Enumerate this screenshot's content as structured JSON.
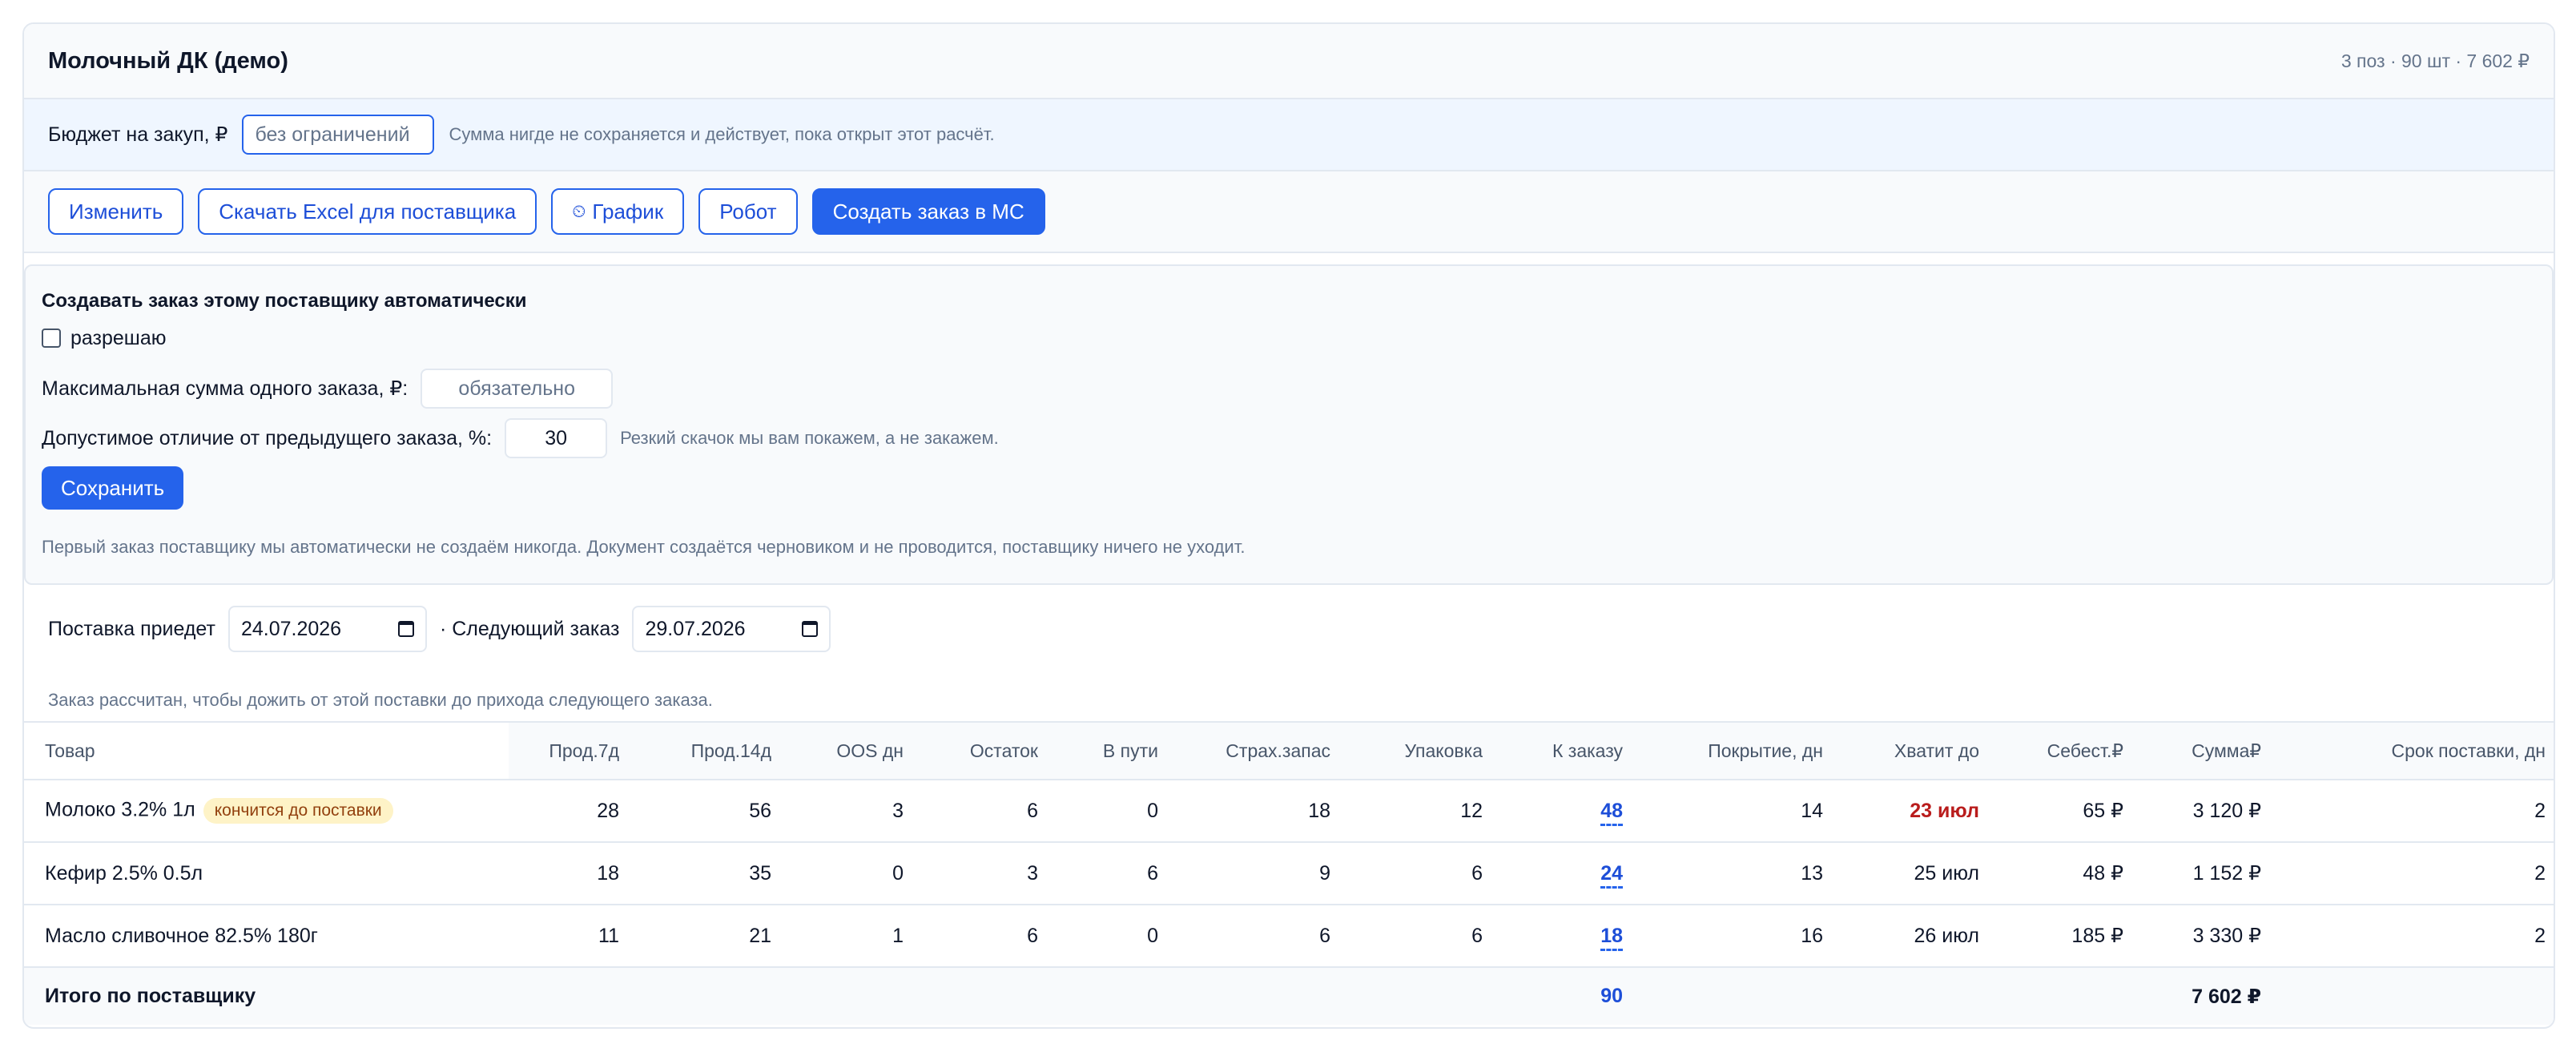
{
  "header": {
    "title": "Молочный ДК (демо)",
    "summary": "3 поз · 90 шт · 7 602 ₽"
  },
  "budget": {
    "label": "Бюджет на закуп, ₽",
    "placeholder": "без ограничений",
    "hint": "Сумма нигде не сохраняется и действует, пока открыт этот расчёт."
  },
  "actions": {
    "edit": "Изменить",
    "excel": "Скачать Excel для поставщика",
    "schedule_icon": "clock-icon",
    "schedule": "График",
    "robot": "Робот",
    "create_order": "Создать заказ в МС"
  },
  "auto_order": {
    "title": "Создавать заказ этому поставщику автоматически",
    "allow_label": "разрешаю",
    "allow_checked": false,
    "max_sum_label": "Максимальная сумма одного заказа, ₽:",
    "max_sum_placeholder": "обязательно",
    "deviation_label": "Допустимое отличие от предыдущего заказа, %:",
    "deviation_value": "30",
    "deviation_hint": "Резкий скачок мы вам покажем, а не закажем.",
    "save": "Сохранить",
    "note": "Первый заказ поставщику мы автоматически не создаём никогда. Документ создаётся черновиком и не проводится, поставщику ничего не уходит."
  },
  "dates": {
    "delivery_label": "Поставка приедет",
    "delivery_value": "24.07.2026",
    "next_label": "· Следующий заказ",
    "next_value": "29.07.2026",
    "note": "Заказ рассчитан, чтобы дожить от этой поставки до прихода следующего заказа."
  },
  "table": {
    "columns": [
      "Товар",
      "Прод.7д",
      "Прод.14д",
      "OOS дн",
      "Остаток",
      "В пути",
      "Страх.запас",
      "Упаковка",
      "К заказу",
      "Покрытие, дн",
      "Хватит до",
      "Себест.₽",
      "Сумма₽",
      "Срок поставки, дн"
    ],
    "rows": [
      {
        "name": "Молоко 3.2% 1л",
        "badge": "кончится до поставки",
        "s7": "28",
        "s14": "56",
        "oos": "3",
        "stock": "6",
        "transit": "0",
        "safety": "18",
        "pack": "12",
        "order": "48",
        "cover": "14",
        "until": "23 июл",
        "until_alert": true,
        "cost": "65 ₽",
        "sum": "3 120 ₽",
        "lead": "2"
      },
      {
        "name": "Кефир 2.5% 0.5л",
        "badge": "",
        "s7": "18",
        "s14": "35",
        "oos": "0",
        "stock": "3",
        "transit": "6",
        "safety": "9",
        "pack": "6",
        "order": "24",
        "cover": "13",
        "until": "25 июл",
        "until_alert": false,
        "cost": "48 ₽",
        "sum": "1 152 ₽",
        "lead": "2"
      },
      {
        "name": "Масло сливочное 82.5% 180г",
        "badge": "",
        "s7": "11",
        "s14": "21",
        "oos": "1",
        "stock": "6",
        "transit": "0",
        "safety": "6",
        "pack": "6",
        "order": "18",
        "cover": "16",
        "until": "26 июл",
        "until_alert": false,
        "cost": "185 ₽",
        "sum": "3 330 ₽",
        "lead": "2"
      }
    ],
    "total": {
      "label": "Итого по поставщику",
      "order": "90",
      "sum": "7 602 ₽"
    }
  }
}
